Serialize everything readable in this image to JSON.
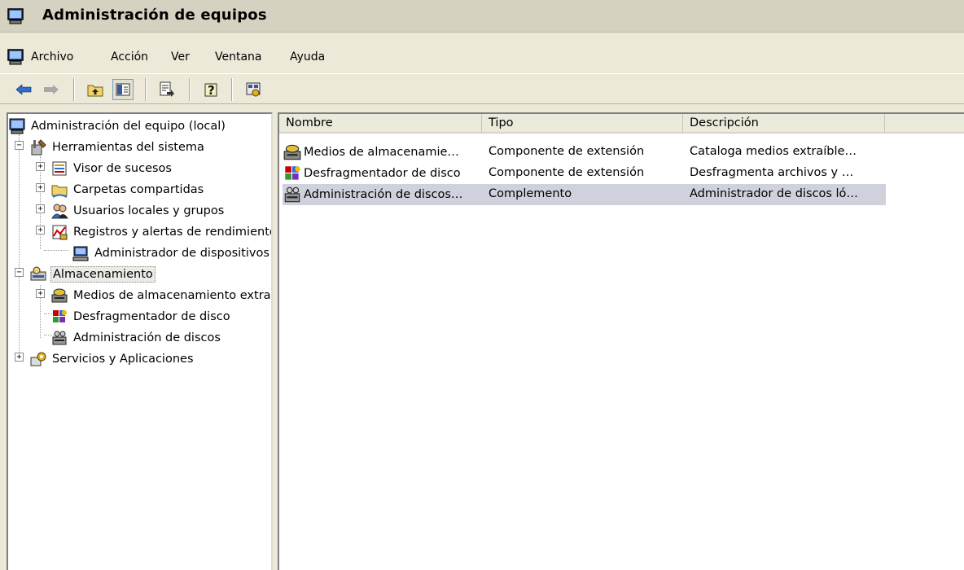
{
  "window": {
    "title": "Administración de equipos"
  },
  "menu": {
    "items": [
      {
        "label": "Archivo"
      },
      {
        "label": "Acción"
      },
      {
        "label": "Ver"
      },
      {
        "label": "Ventana"
      },
      {
        "label": "Ayuda"
      }
    ]
  },
  "toolbar": {
    "buttons": [
      {
        "icon": "back-arrow-icon"
      },
      {
        "icon": "forward-arrow-icon"
      },
      {
        "icon": "up-folder-icon"
      },
      {
        "icon": "show-hide-tree-icon"
      },
      {
        "icon": "export-list-icon"
      },
      {
        "icon": "help-icon"
      },
      {
        "icon": "properties-icon"
      }
    ]
  },
  "tree": {
    "items": [
      {
        "label": "Administración del equipo (local)",
        "icon": "computer-icon"
      },
      {
        "label": "Herramientas del sistema",
        "icon": "tools-icon",
        "expander": "−"
      },
      {
        "label": "Visor de sucesos",
        "icon": "event-viewer-icon",
        "expander": "+"
      },
      {
        "label": "Carpetas compartidas",
        "icon": "shared-folder-icon",
        "expander": "+"
      },
      {
        "label": "Usuarios locales y grupos",
        "icon": "users-icon",
        "expander": "+"
      },
      {
        "label": "Registros y alertas de rendimiento",
        "icon": "performance-icon",
        "expander": "+"
      },
      {
        "label": "Administrador de dispositivos",
        "icon": "device-manager-icon"
      },
      {
        "label": "Almacenamiento",
        "icon": "storage-icon",
        "expander": "−",
        "selected": true
      },
      {
        "label": "Medios de almacenamiento extraíbles",
        "icon": "removable-storage-icon",
        "expander": "+"
      },
      {
        "label": "Desfragmentador de disco",
        "icon": "defrag-icon"
      },
      {
        "label": "Administración de discos",
        "icon": "disk-management-icon"
      },
      {
        "label": "Servicios y Aplicaciones",
        "icon": "services-icon",
        "expander": "+"
      }
    ]
  },
  "list": {
    "columns": [
      {
        "label": "Nombre"
      },
      {
        "label": "Tipo"
      },
      {
        "label": "Descripción"
      }
    ],
    "rows": [
      {
        "name": "Medios de almacenamie…",
        "type": "Componente de extensión",
        "description": "Cataloga medios extraíble…",
        "icon": "removable-storage-icon"
      },
      {
        "name": "Desfragmentador de disco",
        "type": "Componente de extensión",
        "description": "Desfragmenta archivos y …",
        "icon": "defrag-icon"
      },
      {
        "name": "Administración de discos…",
        "type": "Complemento",
        "description": "Administrador de discos ló…",
        "icon": "disk-management-icon",
        "selected": true
      }
    ]
  },
  "colors": {
    "chrome": "#ece9d8",
    "selection": "#cfd1dc",
    "header": "#ebeadb"
  }
}
